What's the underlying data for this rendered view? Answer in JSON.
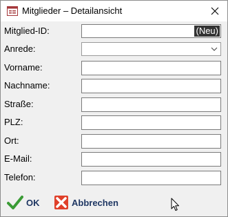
{
  "window": {
    "title": "Mitglieder – Detailansicht",
    "icon": "form-icon"
  },
  "form": {
    "fields": [
      {
        "label": "Mitglied-ID:",
        "value": "",
        "badge": "(Neu)",
        "type": "text"
      },
      {
        "label": "Anrede:",
        "value": "",
        "type": "select"
      },
      {
        "label": "Vorname:",
        "value": "",
        "type": "text"
      },
      {
        "label": "Nachname:",
        "value": "",
        "type": "text"
      },
      {
        "label": "Straße:",
        "value": "",
        "type": "text"
      },
      {
        "label": "PLZ:",
        "value": "",
        "type": "text"
      },
      {
        "label": "Ort:",
        "value": "",
        "type": "text"
      },
      {
        "label": "E-Mail:",
        "value": "",
        "type": "text"
      },
      {
        "label": "Telefon:",
        "value": "",
        "type": "text"
      }
    ]
  },
  "buttons": {
    "ok_label": "OK",
    "cancel_label": "Abbrechen"
  },
  "colors": {
    "ok_check": "#3a9b35",
    "cancel_x": "#e0402a",
    "button_text": "#1f3763"
  }
}
